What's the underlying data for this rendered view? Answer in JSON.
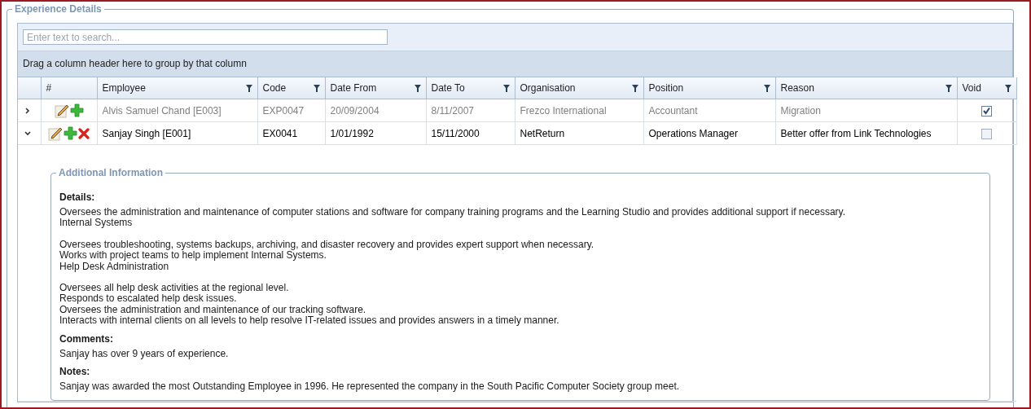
{
  "section_title": "Experience Details",
  "search": {
    "placeholder": "Enter text to search..."
  },
  "group_panel": "Drag a column header here to group by that column",
  "columns": [
    {
      "label": "#",
      "filter": false
    },
    {
      "label": "Employee",
      "filter": true
    },
    {
      "label": "Code",
      "filter": true
    },
    {
      "label": "Date From",
      "filter": true
    },
    {
      "label": "Date To",
      "filter": true
    },
    {
      "label": "Organisation",
      "filter": true
    },
    {
      "label": "Position",
      "filter": true
    },
    {
      "label": "Reason",
      "filter": true
    },
    {
      "label": "Void",
      "filter": true
    }
  ],
  "rows": [
    {
      "expanded": false,
      "deletable": false,
      "void": true,
      "cells": [
        "Alvis Samuel Chand [E003]",
        "EXP0047",
        "20/09/2004",
        "8/11/2007",
        "Frezco International",
        "Accountant",
        "Migration"
      ]
    },
    {
      "expanded": true,
      "deletable": true,
      "void": false,
      "cells": [
        "Sanjay Singh [E001]",
        "EX0041",
        "1/01/1992",
        "15/11/2000",
        "NetReturn",
        "Operations Manager",
        "Better offer from Link Technologies"
      ]
    }
  ],
  "additional_information": {
    "title": "Additional Information",
    "sections": [
      {
        "heading": "Details:",
        "paragraphs": [
          [
            "Oversees the administration and maintenance of computer stations and software for company training programs and the Learning Studio and provides additional support if necessary.",
            "Internal Systems"
          ],
          [
            "Oversees troubleshooting, systems backups, archiving, and disaster recovery and provides expert support when necessary.",
            "Works with project teams to help implement Internal Systems.",
            "Help Desk Administration"
          ],
          [
            "Oversees all help desk activities at the regional level.",
            "Responds to escalated help desk issues.",
            "Oversees the administration and maintenance of our tracking software.",
            "Interacts with internal clients on all levels to help resolve IT-related issues and provides answers in a timely manner."
          ]
        ]
      },
      {
        "heading": "Comments:",
        "paragraphs": [
          [
            "Sanjay has over 9 years of experience."
          ]
        ]
      },
      {
        "heading": "Notes:",
        "paragraphs": [
          [
            "Sanjay was awarded the most Outstanding Employee in 1996. He represented the company in the South Pacific Computer Society group meet."
          ]
        ]
      }
    ]
  }
}
